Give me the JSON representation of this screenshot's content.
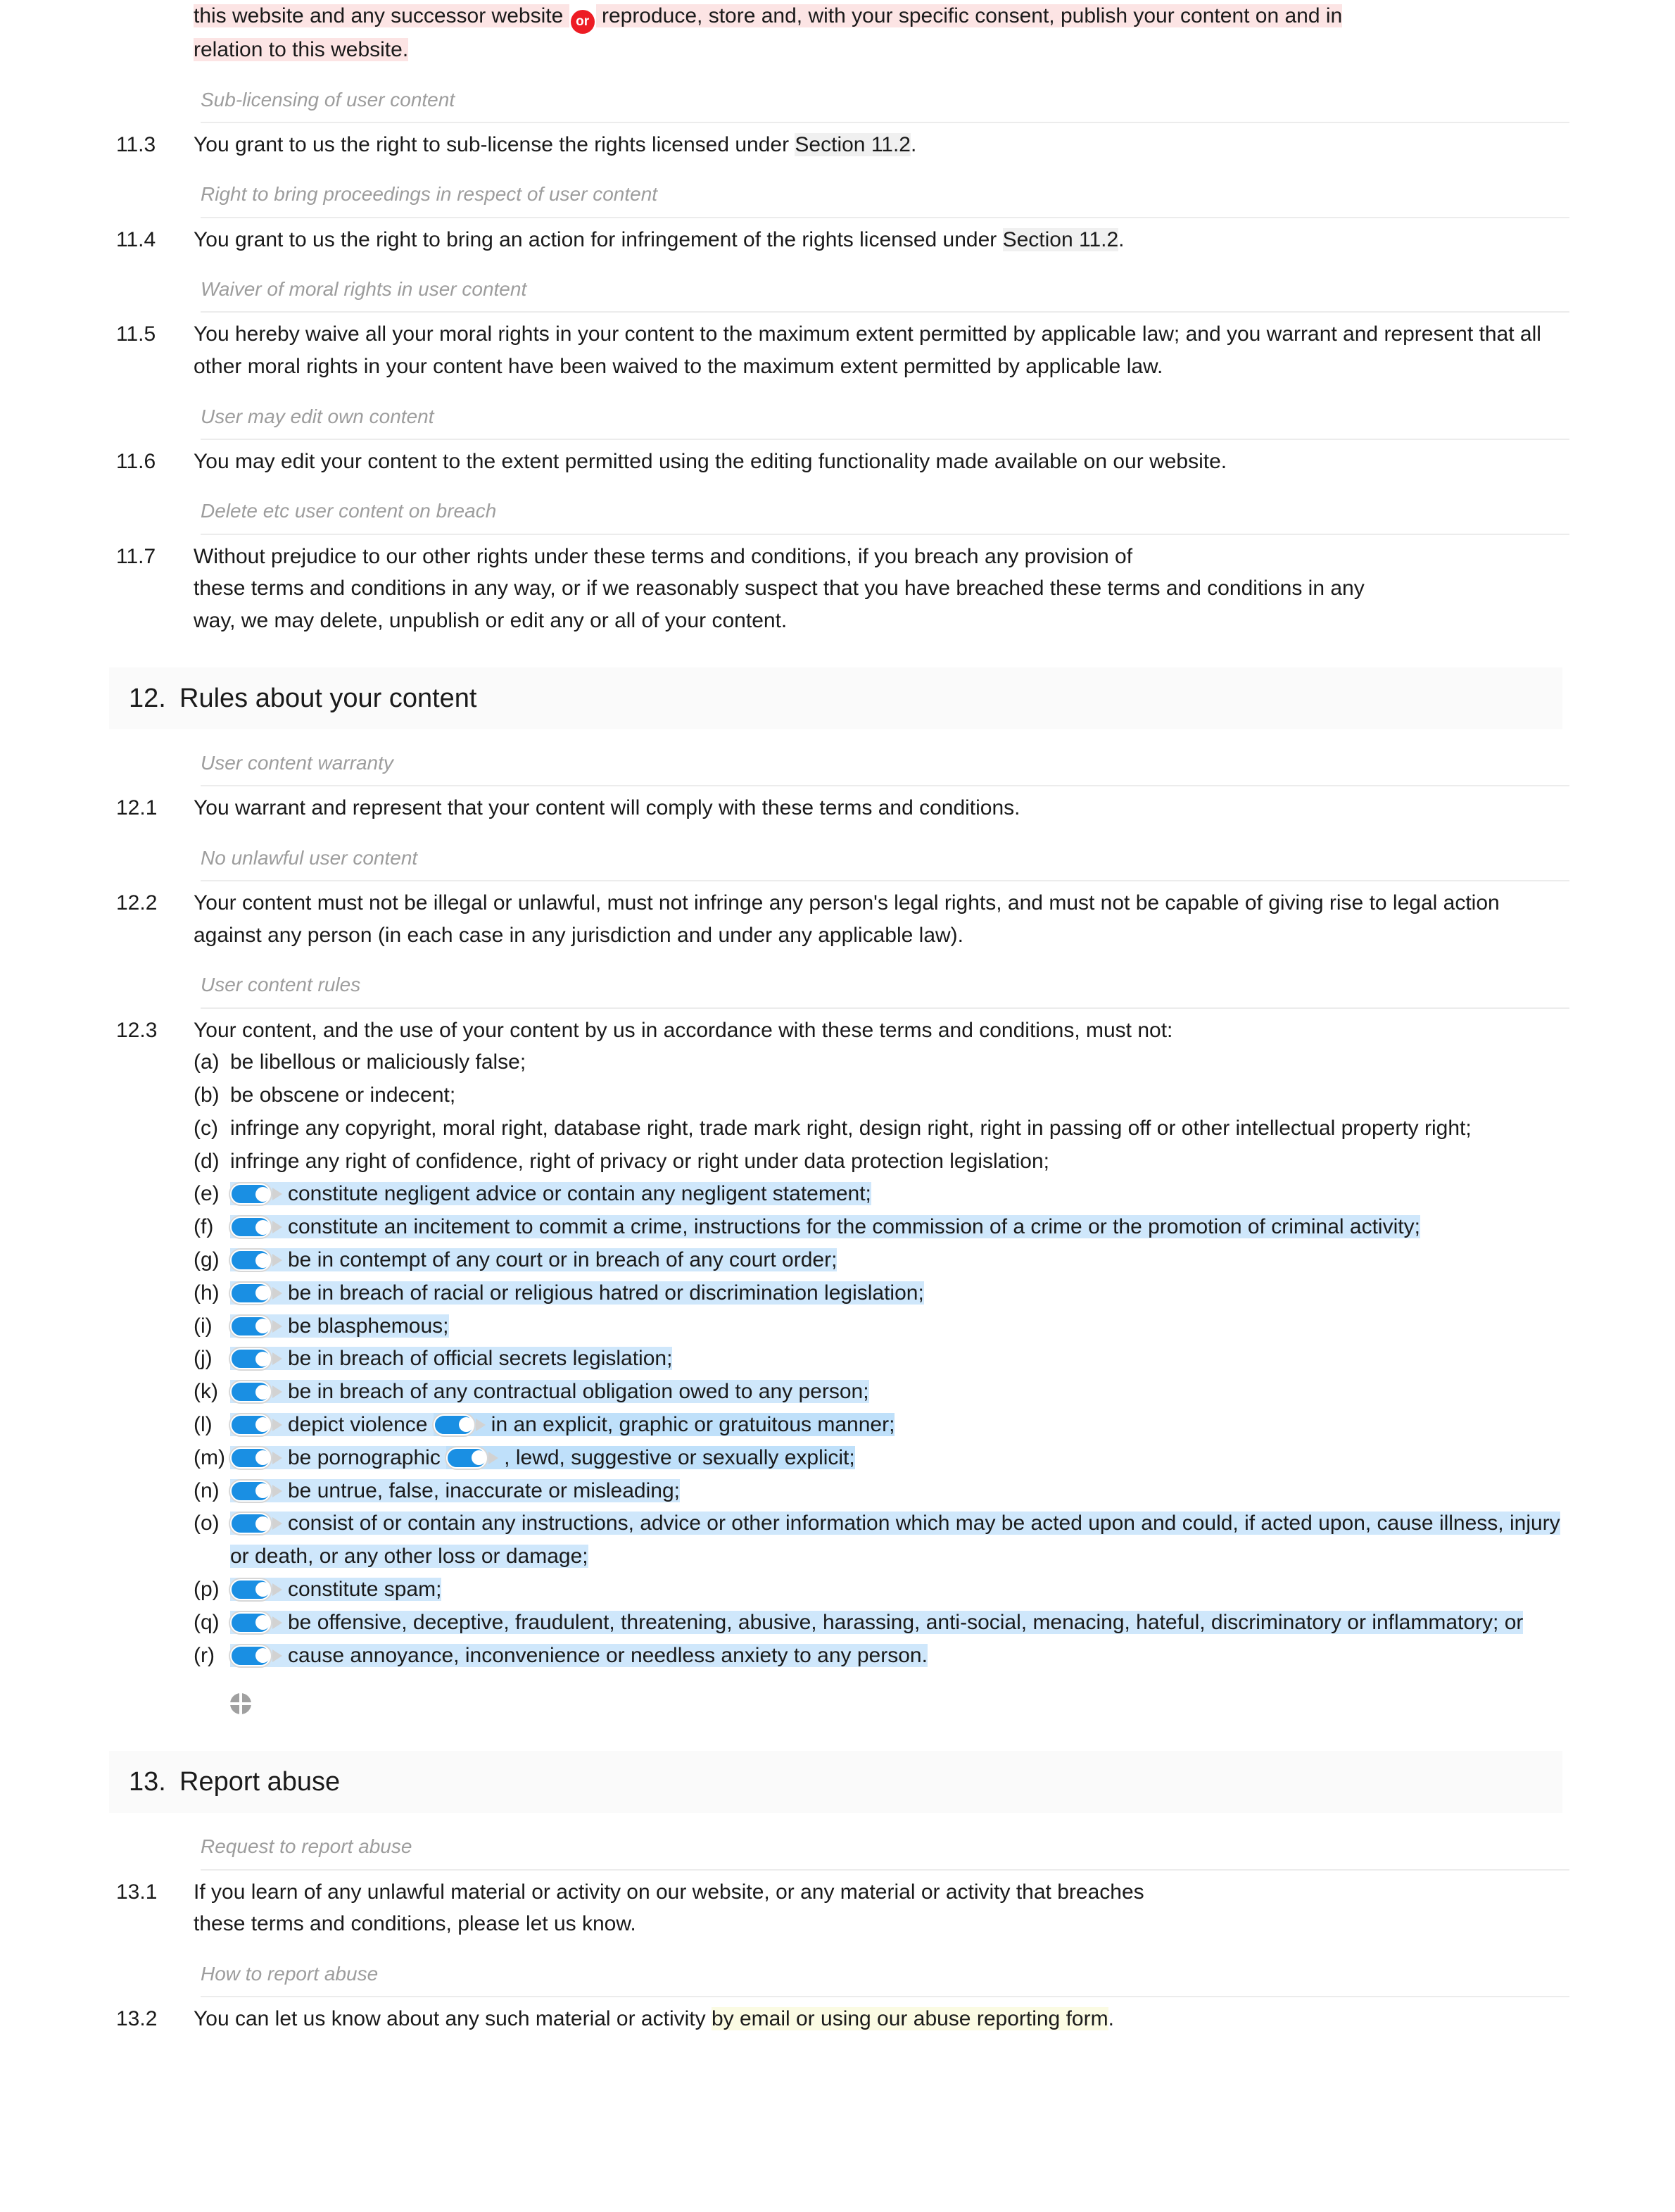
{
  "document": {
    "opening_paragraph": {
      "part1": "this website and any successor website",
      "badge": "or",
      "part2": "reproduce, store and, with your specific consent, publish your content on and in",
      "part3": "relation to this website."
    },
    "clauses": [
      {
        "subheading": "Sub-licensing of user content",
        "number": "11.3",
        "text_before": "You grant to us the right to sub-license the rights licensed under ",
        "ref": "Section 11.2",
        "text_after": "."
      },
      {
        "subheading": "Right to bring proceedings in respect of user content",
        "number": "11.4",
        "text_before": "You grant to us the right to bring an action for infringement of the rights licensed under ",
        "ref": "Section 11.2",
        "text_after": "."
      },
      {
        "subheading": "Waiver of moral rights in user content",
        "number": "11.5",
        "text": "You hereby waive all your moral rights in your content to the maximum extent permitted by applicable law; and you warrant and represent that all other moral rights in your content have been waived to the maximum extent permitted by applicable law."
      },
      {
        "subheading": "User may edit own content",
        "number": "11.6",
        "text": "You may edit your content to the extent permitted using the editing functionality made available on our website."
      },
      {
        "subheading": "Delete etc user content on breach",
        "number": "11.7",
        "line1": "Without prejudice to our other rights under these terms and conditions, if you breach any provision of",
        "line2": "these terms and conditions in any way, or if we reasonably suspect that you have breached these terms and conditions in any",
        "line3": "way, we may delete, unpublish or edit any or all of your content."
      }
    ],
    "section12": {
      "number": "12.",
      "title": "Rules about your content",
      "sub1_heading": "User content warranty",
      "c121_num": "12.1",
      "c121_text": "You warrant and represent that your content will comply with these terms and conditions.",
      "sub2_heading": "No unlawful user content",
      "c122_num": "12.2",
      "c122_text": "Your content must not be illegal or unlawful, must not infringe any person's legal rights, and must not be capable of giving rise to legal action against any person (in each case in any jurisdiction and under any applicable law).",
      "sub3_heading": "User content rules",
      "c123_num": "12.3",
      "c123_intro": "Your content, and the use of your content by us in accordance with these terms and conditions, must not:",
      "items": [
        {
          "letter": "(a)",
          "text": "be libellous or maliciously false;",
          "toggle": false,
          "highlight": false
        },
        {
          "letter": "(b)",
          "text": "be obscene or indecent;",
          "toggle": false,
          "highlight": false
        },
        {
          "letter": "(c)",
          "text": "infringe any copyright, moral right, database right, trade mark right, design right, right in passing off or other intellectual property right;",
          "toggle": false,
          "highlight": false
        },
        {
          "letter": "(d)",
          "text": "infringe any right of confidence, right of privacy or right under data protection legislation;",
          "toggle": false,
          "highlight": false
        },
        {
          "letter": "(e)",
          "text": "constitute negligent advice or contain any negligent statement;",
          "toggle": true,
          "highlight": true
        },
        {
          "letter": "(f)",
          "text": "constitute an incitement to commit a crime, instructions for the commission of a crime or the promotion of criminal activity;",
          "toggle": true,
          "highlight": true
        },
        {
          "letter": "(g)",
          "text": "be in contempt of any court or in breach of any court order;",
          "toggle": true,
          "highlight": true
        },
        {
          "letter": "(h)",
          "text": "be in breach of racial or religious hatred or discrimination legislation;",
          "toggle": true,
          "highlight": true
        },
        {
          "letter": "(i)",
          "text": "be blasphemous;",
          "toggle": true,
          "highlight": true
        },
        {
          "letter": "(j)",
          "text": "be in breach of official secrets legislation;",
          "toggle": true,
          "highlight": true
        },
        {
          "letter": "(k)",
          "text": "be in breach of any contractual obligation owed to any person;",
          "toggle": true,
          "highlight": true
        },
        {
          "letter": "(l)",
          "text_a": "depict violence",
          "text_b": "in an explicit, graphic or gratuitous manner;",
          "toggle": true,
          "toggle2": true,
          "highlight": true
        },
        {
          "letter": "(m)",
          "text_a": "be pornographic",
          "text_b": ", lewd, suggestive or sexually explicit;",
          "toggle": true,
          "toggle2": true,
          "highlight": true
        },
        {
          "letter": "(n)",
          "text": "be untrue, false, inaccurate or misleading;",
          "toggle": true,
          "highlight": true
        },
        {
          "letter": "(o)",
          "text": "consist of or contain any instructions, advice or other information which may be acted upon and could, if acted upon, cause illness, injury or death, or any other loss or damage;",
          "toggle": true,
          "highlight": true
        },
        {
          "letter": "(p)",
          "text": "constitute spam;",
          "toggle": true,
          "highlight": true
        },
        {
          "letter": "(q)",
          "text": "be offensive, deceptive, fraudulent, threatening, abusive, harassing, anti-social, menacing, hateful, discriminatory or inflammatory; or",
          "toggle": true,
          "highlight": true
        },
        {
          "letter": "(r)",
          "text": "cause annoyance, inconvenience or needless anxiety to any person.",
          "toggle": true,
          "highlight": true
        }
      ]
    },
    "section13": {
      "number": "13.",
      "title": "Report abuse",
      "sub1_heading": "Request to report abuse",
      "c131_num": "13.1",
      "c131_line1": "If you learn of any unlawful material or activity on our website, or any material or activity that breaches",
      "c131_line2": "these terms and conditions, please let us know.",
      "sub2_heading": "How to report abuse",
      "c132_num": "13.2",
      "c132_before": "You can let us know about any such material or activity ",
      "c132_highlight": "by email or using our abuse reporting form",
      "c132_after": "."
    },
    "icons": {
      "move_handle": "move-handle-icon",
      "or_badge": "or-badge-icon"
    },
    "colors": {
      "toggle_on": "#1a8fe3",
      "highlight_blue": "#cfe7fb",
      "highlight_blue_alt": "#bfe0fa",
      "highlight_pink": "#fce4e4",
      "highlight_gray": "#f0f0f0",
      "highlight_cream": "#fbfbe3",
      "badge_red": "#ed1c24",
      "section_band": "#fafafa",
      "subheading_text": "#9d9d9d"
    }
  }
}
